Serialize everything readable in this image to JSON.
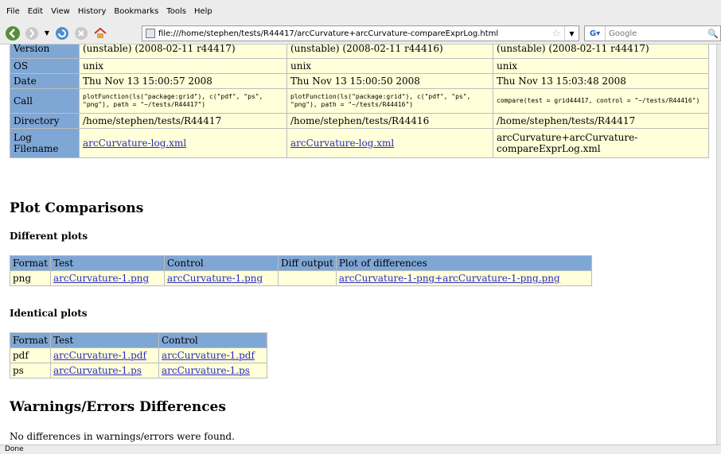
{
  "menu": [
    "File",
    "Edit",
    "View",
    "History",
    "Bookmarks",
    "Tools",
    "Help"
  ],
  "url": "file:///home/stephen/tests/R44417/arcCurvature+arcCurvature-compareExprLog.html",
  "search_placeholder": "Google",
  "info_rows": [
    {
      "label": "Version",
      "c1": "(unstable) (2008-02-11 r44417)",
      "c2": "(unstable) (2008-02-11 r44416)",
      "c3": "(unstable) (2008-02-11 r44417)"
    },
    {
      "label": "OS",
      "c1": "unix",
      "c2": "unix",
      "c3": "unix"
    },
    {
      "label": "Date",
      "c1": "Thu Nov 13 15:00:57 2008",
      "c2": "Thu Nov 13 15:00:50 2008",
      "c3": "Thu Nov 13 15:03:48 2008"
    },
    {
      "label": "Call",
      "c1": "plotFunction(ls(\"package:grid\"), c(\"pdf\", \"ps\", \"png\"), path = \"~/tests/R44417\")",
      "c2": "plotFunction(ls(\"package:grid\"), c(\"pdf\", \"ps\", \"png\"), path = \"~/tests/R44416\")",
      "c3": "compare(test = grid44417, control = \"~/tests/R44416\")"
    },
    {
      "label": "Directory",
      "c1": "/home/stephen/tests/R44417",
      "c2": "/home/stephen/tests/R44416",
      "c3": "/home/stephen/tests/R44417"
    },
    {
      "label": "Log Filename",
      "c1": "arcCurvature-log.xml",
      "c2": "arcCurvature-log.xml",
      "c3": "arcCurvature+arcCurvature-compareExprLog.xml"
    }
  ],
  "plot_comparisons_title": "Plot Comparisons",
  "different_plots_title": "Different plots",
  "different_headers": [
    "Format",
    "Test",
    "Control",
    "Diff output",
    "Plot of differences"
  ],
  "different_rows": [
    {
      "format": "png",
      "test": "arcCurvature-1.png",
      "control": "arcCurvature-1.png",
      "diff": "",
      "plot": "arcCurvature-1-png+arcCurvature-1-png.png"
    }
  ],
  "identical_plots_title": "Identical plots",
  "identical_headers": [
    "Format",
    "Test",
    "Control"
  ],
  "identical_rows": [
    {
      "format": "pdf",
      "test": "arcCurvature-1.pdf",
      "control": "arcCurvature-1.pdf"
    },
    {
      "format": "ps",
      "test": "arcCurvature-1.ps",
      "control": "arcCurvature-1.ps"
    }
  ],
  "warnings_title": "Warnings/Errors Differences",
  "warnings_note": "No differences in warnings/errors were found.",
  "status": "Done"
}
